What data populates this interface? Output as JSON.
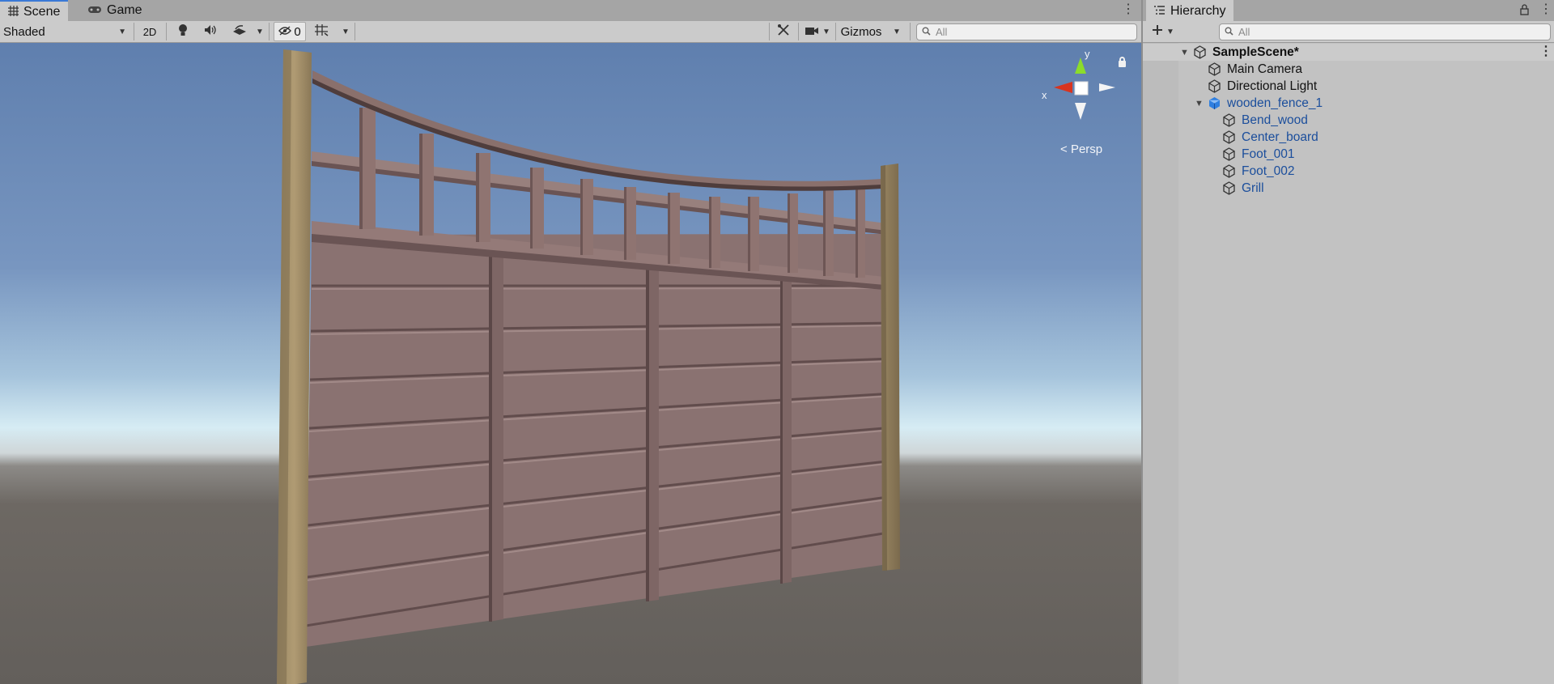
{
  "scene_window": {
    "tabs": [
      {
        "label": "Scene",
        "icon": "grid-icon",
        "active": true
      },
      {
        "label": "Game",
        "icon": "gamepad-icon",
        "active": false
      }
    ],
    "toolbar": {
      "shading_mode": "Shaded",
      "toggle_2d": "2D",
      "hidden_count": "0",
      "gizmos_label": "Gizmos",
      "search_placeholder": "All"
    },
    "view_gizmo": {
      "x_label": "x",
      "y_label": "y",
      "projection_label": "Persp"
    }
  },
  "hierarchy": {
    "title": "Hierarchy",
    "search_placeholder": "All",
    "items": [
      {
        "label": "SampleScene*",
        "kind": "scene",
        "depth": 0,
        "expanded": true
      },
      {
        "label": "Main Camera",
        "kind": "gameobject",
        "depth": 1
      },
      {
        "label": "Directional Light",
        "kind": "gameobject",
        "depth": 1
      },
      {
        "label": "wooden_fence_1",
        "kind": "prefab",
        "depth": 1,
        "expanded": true
      },
      {
        "label": "Bend_wood",
        "kind": "prefab-child",
        "depth": 2
      },
      {
        "label": "Center_board",
        "kind": "prefab-child",
        "depth": 2
      },
      {
        "label": "Foot_001",
        "kind": "prefab-child",
        "depth": 2
      },
      {
        "label": "Foot_002",
        "kind": "prefab-child",
        "depth": 2
      },
      {
        "label": "Grill",
        "kind": "prefab-child",
        "depth": 2
      }
    ]
  },
  "colors": {
    "accent_tab": "#3a79d6",
    "prefab_text": "#1b4e9c",
    "prefab_icon": "#2f7fe0",
    "gizmo_x": "#d8341f",
    "gizmo_y": "#8cdc2a"
  }
}
